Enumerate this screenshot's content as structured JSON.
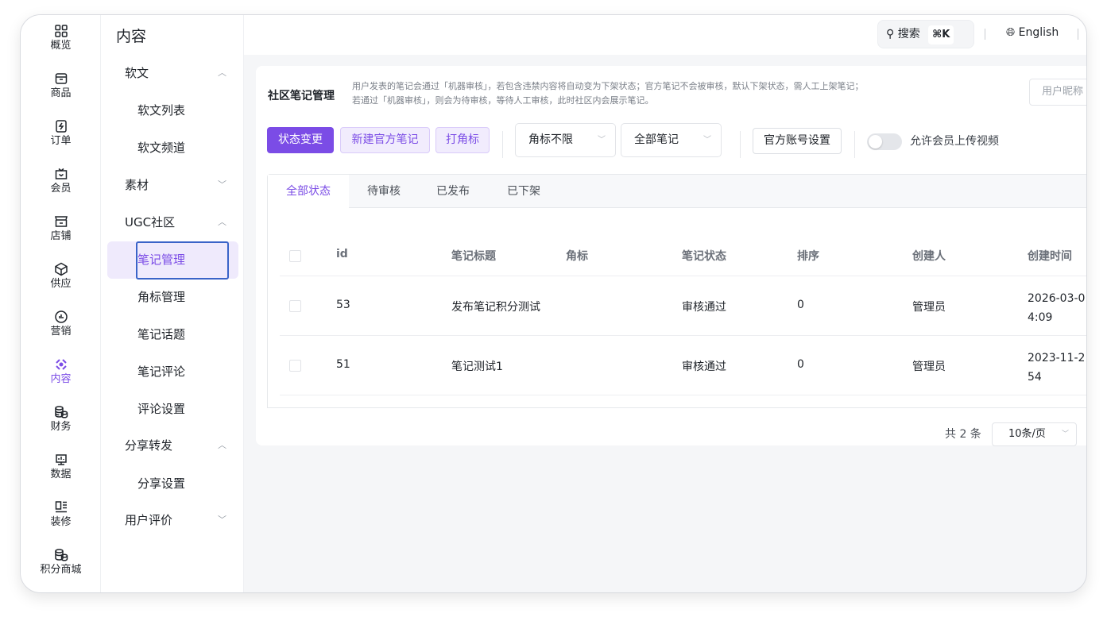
{
  "rail": {
    "items": [
      {
        "label": "概览",
        "icon": "grid-icon"
      },
      {
        "label": "商品",
        "icon": "bag-icon"
      },
      {
        "label": "订单",
        "icon": "order-icon"
      },
      {
        "label": "会员",
        "icon": "member-icon"
      },
      {
        "label": "店铺",
        "icon": "store-icon"
      },
      {
        "label": "供应",
        "icon": "box-icon"
      },
      {
        "label": "营销",
        "icon": "marketing-icon"
      },
      {
        "label": "内容",
        "icon": "content-icon"
      },
      {
        "label": "财务",
        "icon": "coins-icon"
      },
      {
        "label": "数据",
        "icon": "chart-icon"
      },
      {
        "label": "装修",
        "icon": "layout-icon"
      },
      {
        "label": "积分商城",
        "icon": "points-icon"
      }
    ]
  },
  "submenu": {
    "title": "内容",
    "groups": [
      {
        "label": "软文",
        "chevron": "︿"
      },
      {
        "label": "素材",
        "chevron": "﹀"
      },
      {
        "label": "UGC社区",
        "chevron": "︿"
      },
      {
        "label": "分享转发",
        "chevron": "︿"
      },
      {
        "label": "用户评价",
        "chevron": "﹀"
      }
    ],
    "items": {
      "softtext_list": "软文列表",
      "softtext_channel": "软文频道",
      "note_manage": "笔记管理",
      "corner_manage": "角标管理",
      "note_topic": "笔记话题",
      "note_comment": "笔记评论",
      "comment_settings": "评论设置",
      "share_settings": "分享设置"
    }
  },
  "topbar": {
    "search_label": "搜索",
    "search_kbd": "⌘K",
    "language": "English",
    "sep": "|"
  },
  "card": {
    "title": "社区笔记管理",
    "desc_line1": "用户发表的笔记会通过「机器审核」，若包含违禁内容将自动变为下架状态；官方笔记不会被审核，默认下架状态，需人工上架笔记；",
    "desc_line2": "若通过「机器审核」，则会为待审核，等待人工审核，此时社区内会展示笔记。",
    "nickname_placeholder": "用户昵称"
  },
  "toolbar": {
    "status_change": "状态变更",
    "new_official_note": "新建官方笔记",
    "mark_corner": "打角标",
    "corner_select": "角标不限",
    "notes_select": "全部笔记",
    "official_account": "官方账号设置",
    "allow_video_label": "允许会员上传视频",
    "allow_video_enabled": false
  },
  "tabs": [
    "全部状态",
    "待审核",
    "已发布",
    "已下架"
  ],
  "table": {
    "columns": {
      "id": "id",
      "title": "笔记标题",
      "corner": "角标",
      "status": "笔记状态",
      "sort": "排序",
      "creator": "创建人",
      "created": "创建时间"
    },
    "rows": [
      {
        "id": "53",
        "title": "发布笔记积分测试",
        "corner": "",
        "status": "审核通过",
        "sort": "0",
        "creator": "管理员",
        "created_1": "2026-03-0",
        "created_2": "4:09"
      },
      {
        "id": "51",
        "title": "笔记测试1",
        "corner": "",
        "status": "审核通过",
        "sort": "0",
        "creator": "管理员",
        "created_1": "2023-11-2",
        "created_2": "54"
      }
    ]
  },
  "pagination": {
    "total": "共 2 条",
    "page_size": "10条/页"
  },
  "colors": {
    "accent": "#7b4ce6",
    "accent_light": "#f1ecfd",
    "focus": "#3a64c8"
  }
}
